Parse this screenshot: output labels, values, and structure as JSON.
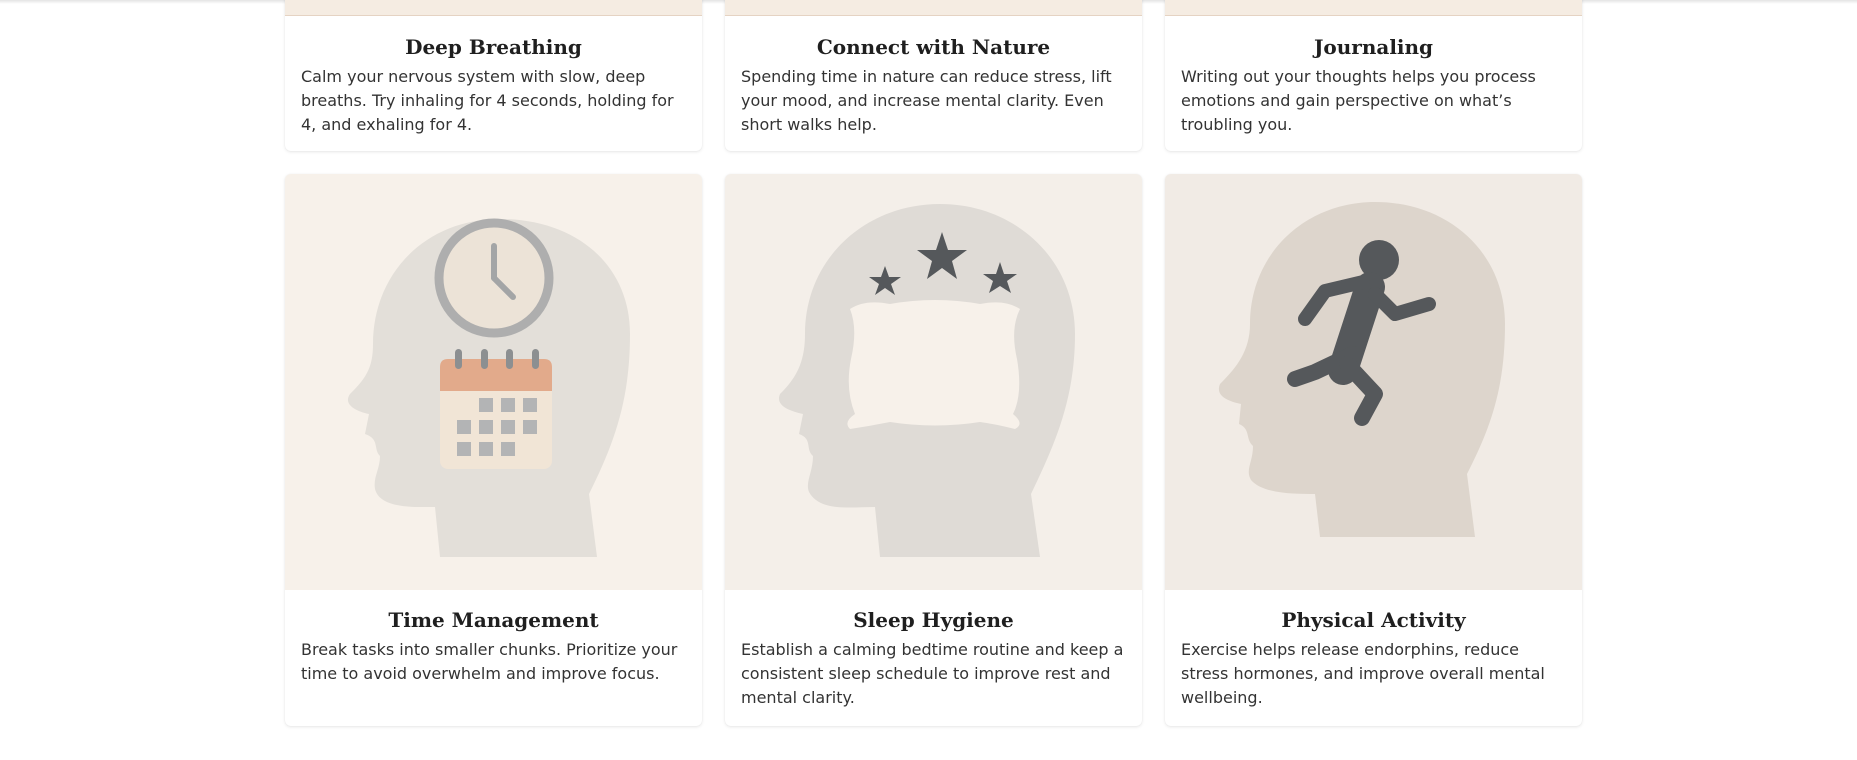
{
  "cards": [
    {
      "title": "Deep Breathing",
      "text": "Calm your nervous system with slow, deep breaths. Try inhaling for 4 seconds, holding for 4, and exhaling for 4.",
      "illustration": "breathing-head-icon"
    },
    {
      "title": "Connect with Nature",
      "text": "Spending time in nature can reduce stress, lift your mood, and increase mental clarity. Even short walks help.",
      "illustration": "nature-head-icon"
    },
    {
      "title": "Journaling",
      "text": "Writing out your thoughts helps you process emotions and gain perspective on what’s troubling you.",
      "illustration": "journal-head-icon"
    },
    {
      "title": "Time Management",
      "text": "Break tasks into smaller chunks. Prioritize your time to avoid overwhelm and improve focus.",
      "illustration": "head-clock-calendar-icon"
    },
    {
      "title": "Sleep Hygiene",
      "text": "Establish a calming bedtime routine and keep a consistent sleep schedule to improve rest and mental clarity.",
      "illustration": "head-pillow-stars-icon"
    },
    {
      "title": "Physical Activity",
      "text": "Exercise helps release endorphins, reduce stress hormones, and improve overall mental wellbeing.",
      "illustration": "head-running-person-icon"
    }
  ],
  "colors": {
    "card_bg": "#ffffff",
    "illustration_bg": "#f7f1ea",
    "head_gray": "#e0dcd6",
    "icon_dark": "#55585b",
    "accent_peach": "#e3ab8a"
  }
}
